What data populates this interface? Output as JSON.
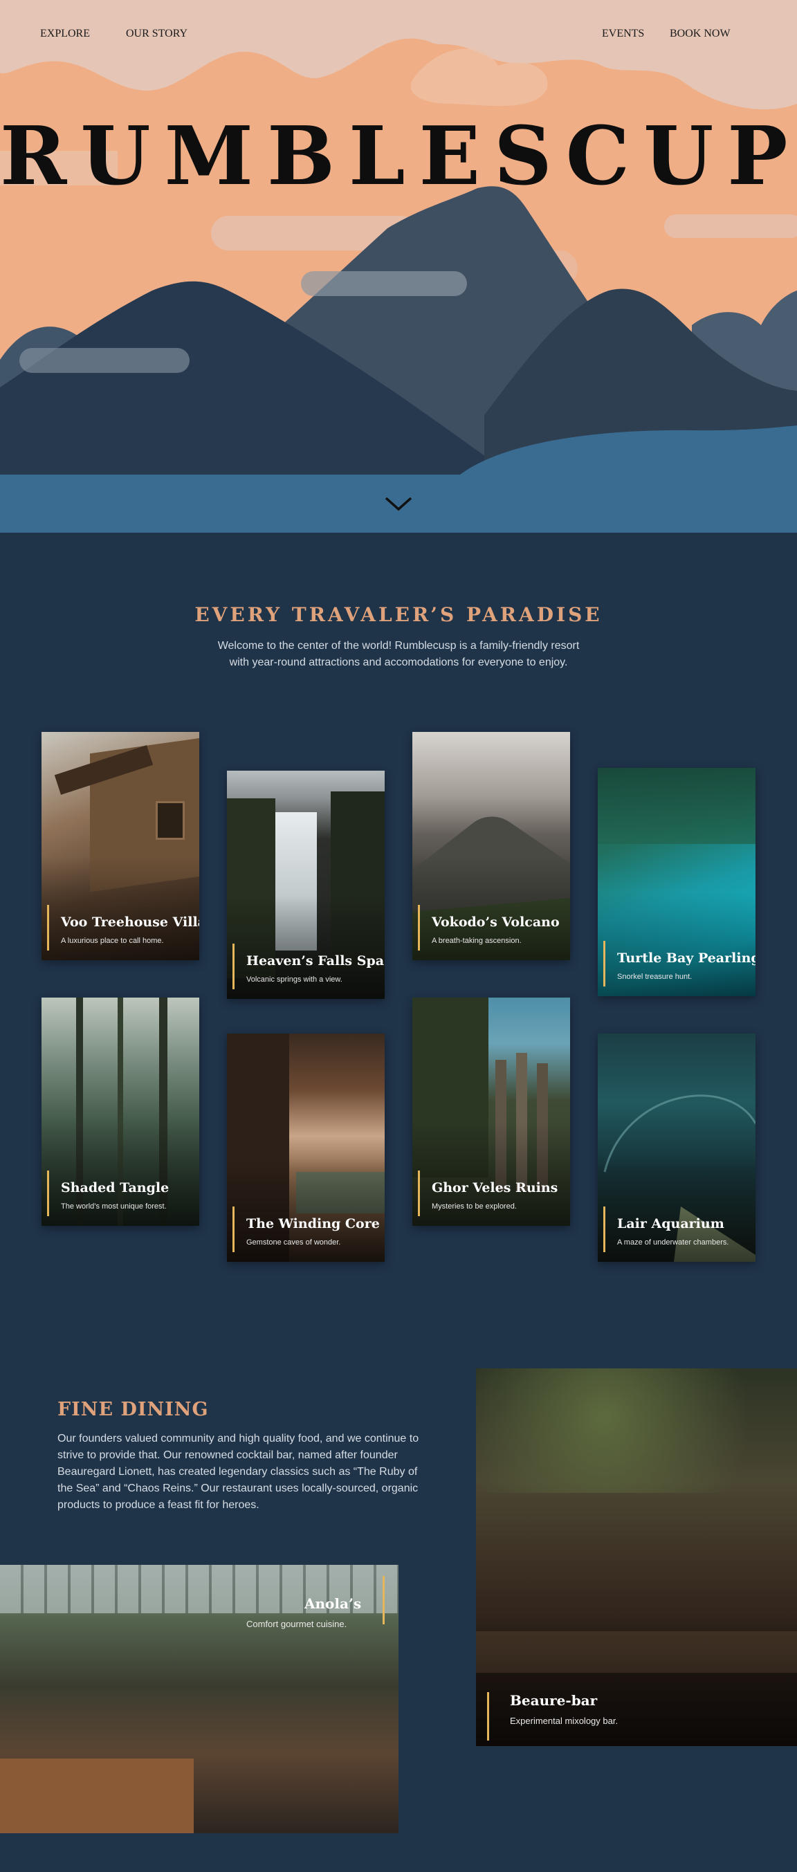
{
  "nav": {
    "explore": "EXPLORE",
    "our_story": "OUR STORY",
    "events": "EVENTS",
    "book_now": "BOOK NOW"
  },
  "hero": {
    "title": "RUMBLESCUP",
    "scroll_icon": "chevron-down-icon"
  },
  "attractions": {
    "title": "EVERY TRAVALER’S PARADISE",
    "intro": "Welcome to the center of the world! Rumblecusp is a family-friendly resort with year-round attractions and accomodations for everyone to enjoy.",
    "cards": [
      {
        "title": "Voo Treehouse Villas",
        "subtitle": "A luxurious place to call home."
      },
      {
        "title": "Heaven’s Falls Spa",
        "subtitle": "Volcanic springs with a view."
      },
      {
        "title": "Vokodo’s Volcano",
        "subtitle": "A breath-taking ascension."
      },
      {
        "title": "Turtle Bay Pearling",
        "subtitle": "Snorkel treasure hunt."
      },
      {
        "title": "Shaded Tangle",
        "subtitle": "The world’s most unique forest."
      },
      {
        "title": "The Winding Core",
        "subtitle": "Gemstone caves of wonder."
      },
      {
        "title": "Ghor Veles Ruins",
        "subtitle": "Mysteries to be explored."
      },
      {
        "title": "Lair Aquarium",
        "subtitle": "A maze of underwater chambers."
      }
    ]
  },
  "dining": {
    "title": "FINE DINING",
    "text": "Our founders valued community and high quality food, and we continue to strive to provide that. Our renowned cocktail bar, named after founder Beauregard Lionett, has created legendary classics such as “The Ruby of the Sea” and “Chaos Reins.” Our restaurant uses locally-sourced, organic products to produce a feast fit for heroes.",
    "bar": {
      "title": "Beaure-bar",
      "subtitle": "Experimental mixology bar."
    },
    "restaurant": {
      "title": "Anola’s",
      "subtitle": "Comfort gourmet cuisine."
    }
  },
  "colors": {
    "background": "#1f3349",
    "accent": "#e0a27a",
    "highlight_bar": "#e6b75a",
    "sky": "#f0ae86",
    "water": "#3a6b91"
  }
}
